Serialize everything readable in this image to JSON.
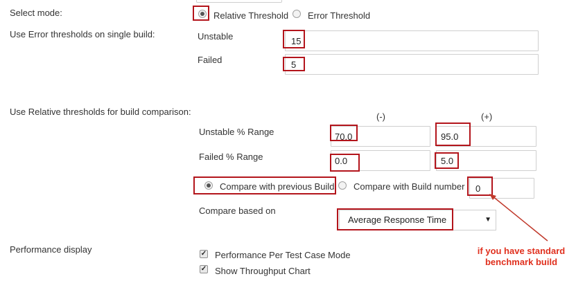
{
  "select_mode": {
    "label": "Select mode:",
    "options": [
      {
        "label": "Relative Threshold",
        "selected": true
      },
      {
        "label": "Error Threshold",
        "selected": false
      }
    ]
  },
  "error_thresholds": {
    "label": "Use Error thresholds on single build:",
    "unstable_label": "Unstable",
    "unstable_value": "15",
    "failed_label": "Failed",
    "failed_value": "5"
  },
  "relative_thresholds": {
    "label": "Use Relative thresholds for build comparison:",
    "minus_header": "(-)",
    "plus_header": "(+)",
    "unstable_label": "Unstable % Range",
    "unstable_minus": "70.0",
    "unstable_plus": "95.0",
    "failed_label": "Failed % Range",
    "failed_minus": "0.0",
    "failed_plus": "5.0",
    "compare_previous_label": "Compare with previous Build",
    "compare_previous_selected": true,
    "compare_build_label": "Compare with Build number",
    "compare_build_selected": false,
    "build_number_value": "0",
    "compare_based_label": "Compare based on",
    "compare_based_value": "Average Response Time"
  },
  "performance_display": {
    "label": "Performance display",
    "options": [
      {
        "label": "Performance Per Test Case Mode",
        "checked": true
      },
      {
        "label": "Show Throughput Chart",
        "checked": true
      }
    ]
  },
  "annotation": {
    "line1": "if you have standard",
    "line2": "benchmark build"
  },
  "colors": {
    "highlight": "#b3141b",
    "annotation": "#e0301e"
  }
}
